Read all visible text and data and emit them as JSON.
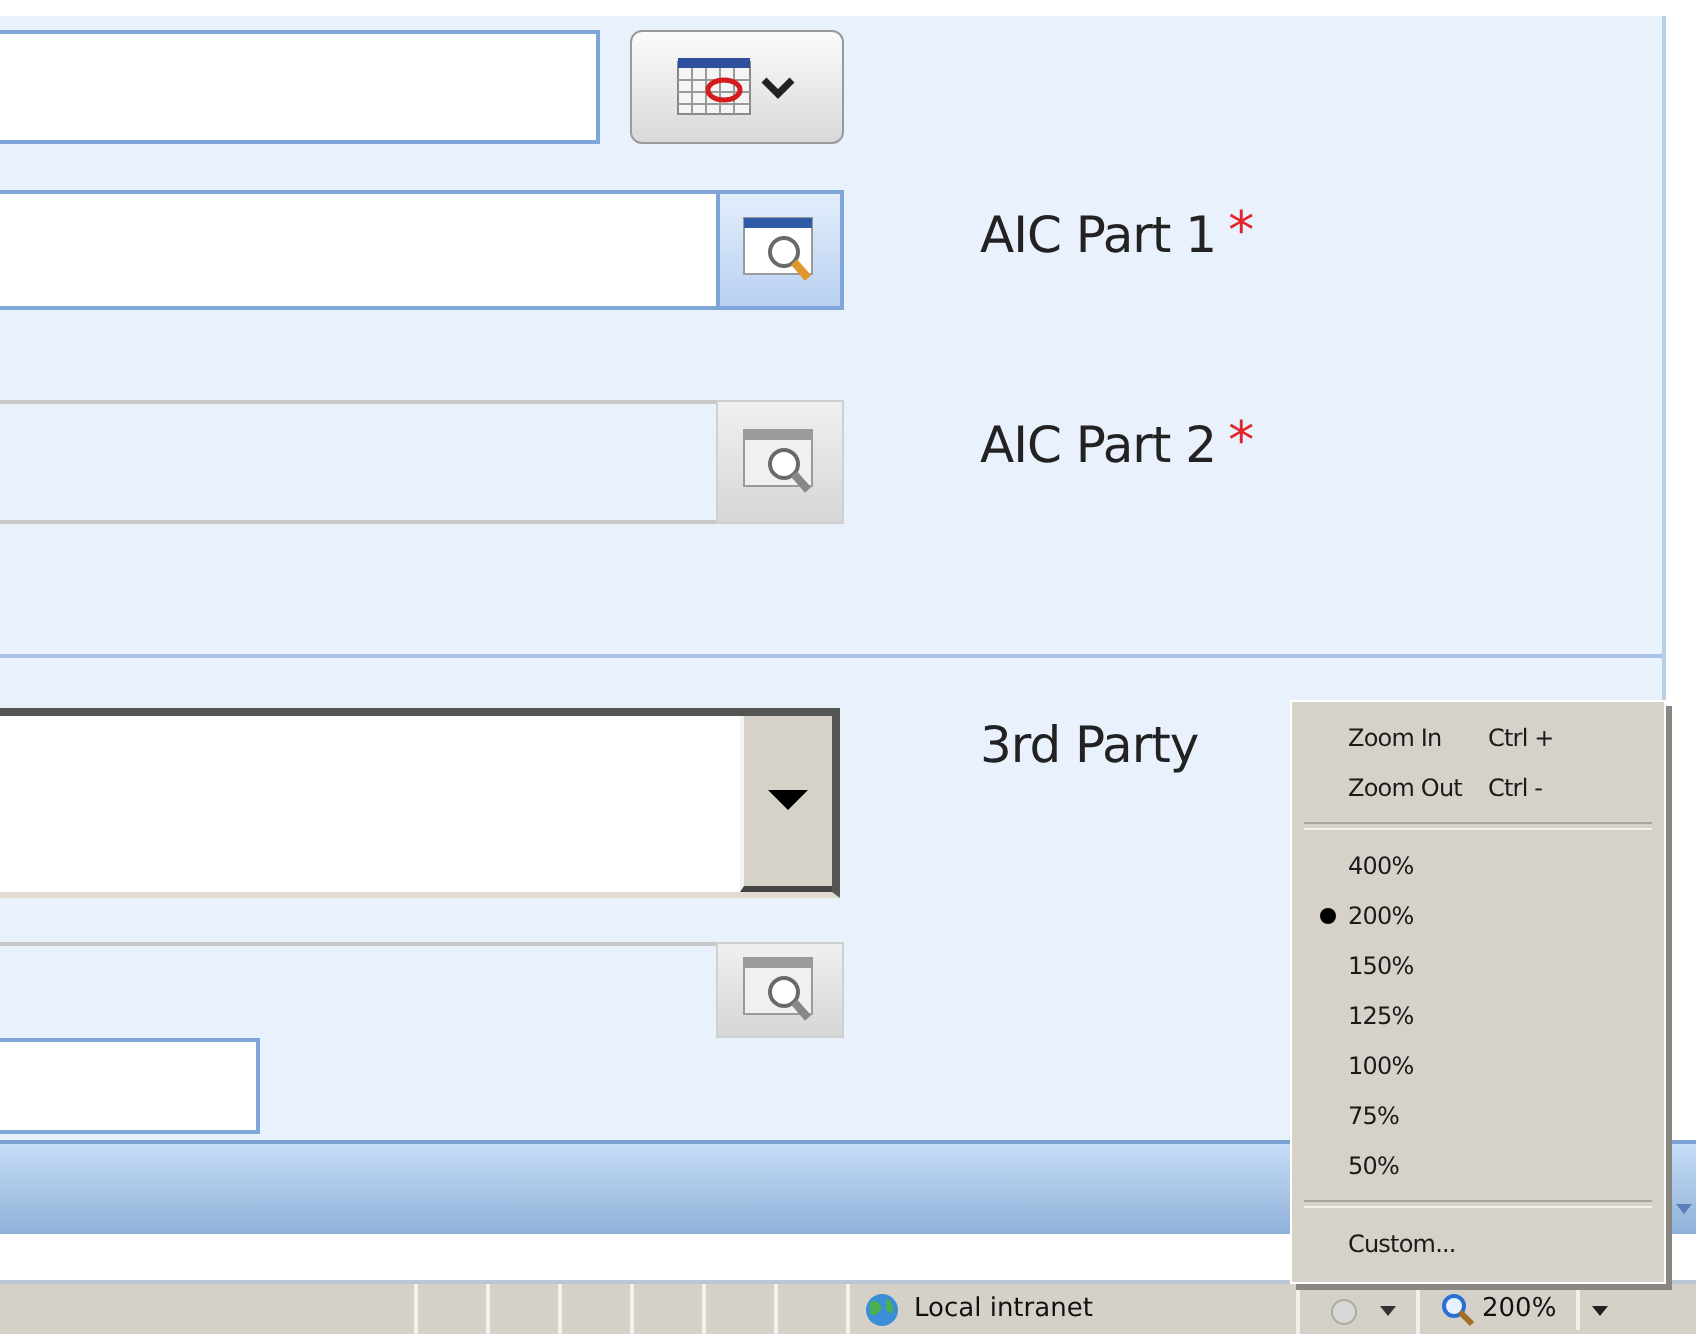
{
  "form": {
    "date_field": {
      "disabled": false
    },
    "lookups": [
      {
        "label": "AIC Part 1",
        "required_marker": "*",
        "disabled": false
      },
      {
        "label": "AIC Part 2",
        "required_marker": "*",
        "disabled": true
      }
    ],
    "third_party": {
      "label": "3rd Party"
    }
  },
  "zoom_menu": [
    {
      "kind": "command",
      "label": "Zoom In",
      "shortcut": "Ctrl +"
    },
    {
      "kind": "command",
      "label": "Zoom Out",
      "shortcut": "Ctrl -"
    },
    {
      "kind": "separator"
    },
    {
      "kind": "option",
      "label": "400%",
      "selected": false
    },
    {
      "kind": "option",
      "label": "200%",
      "selected": true
    },
    {
      "kind": "option",
      "label": "150%",
      "selected": false
    },
    {
      "kind": "option",
      "label": "125%",
      "selected": false
    },
    {
      "kind": "option",
      "label": "100%",
      "selected": false
    },
    {
      "kind": "option",
      "label": "75%",
      "selected": false
    },
    {
      "kind": "option",
      "label": "50%",
      "selected": false
    },
    {
      "kind": "separator"
    },
    {
      "kind": "command",
      "label": "Custom..."
    }
  ],
  "status_bar": {
    "zone": "Local intranet",
    "zoom": "200%"
  }
}
